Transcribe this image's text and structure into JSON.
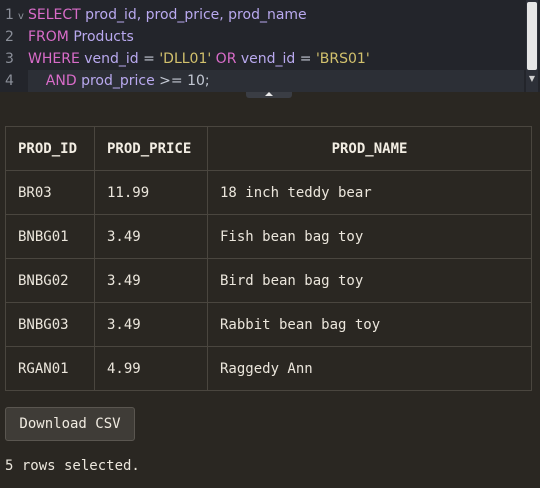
{
  "editor": {
    "lines": [
      {
        "num": "1",
        "tokens": [
          {
            "t": "SELECT",
            "c": "kw"
          },
          {
            "t": " prod_id, prod_price, prod_name",
            "c": "id"
          }
        ]
      },
      {
        "num": "2",
        "tokens": [
          {
            "t": "FROM",
            "c": "kw"
          },
          {
            "t": " Products",
            "c": "id"
          }
        ]
      },
      {
        "num": "3",
        "tokens": [
          {
            "t": "WHERE",
            "c": "kw"
          },
          {
            "t": " vend_id ",
            "c": "id"
          },
          {
            "t": "=",
            "c": "op"
          },
          {
            "t": " 'DLL01' ",
            "c": "str"
          },
          {
            "t": "OR",
            "c": "kw"
          },
          {
            "t": " vend_id ",
            "c": "id"
          },
          {
            "t": "=",
            "c": "op"
          },
          {
            "t": " 'BRS01'",
            "c": "str"
          }
        ]
      },
      {
        "num": "4",
        "tokens": [
          {
            "t": "    AND",
            "c": "kw"
          },
          {
            "t": " prod_price ",
            "c": "id"
          },
          {
            "t": ">=",
            "c": "op"
          },
          {
            "t": " 10;",
            "c": "num"
          }
        ]
      }
    ],
    "fold_glyph": "v"
  },
  "results": {
    "columns": [
      "PROD_ID",
      "PROD_PRICE",
      "PROD_NAME"
    ],
    "rows": [
      [
        "BR03",
        "11.99",
        "18 inch teddy bear"
      ],
      [
        "BNBG01",
        "3.49",
        "Fish bean bag toy"
      ],
      [
        "BNBG02",
        "3.49",
        "Bird bean bag toy"
      ],
      [
        "BNBG03",
        "3.49",
        "Rabbit bean bag toy"
      ],
      [
        "RGAN01",
        "4.99",
        "Raggedy Ann"
      ]
    ]
  },
  "download_label": "Download CSV",
  "status_text": "5 rows selected."
}
